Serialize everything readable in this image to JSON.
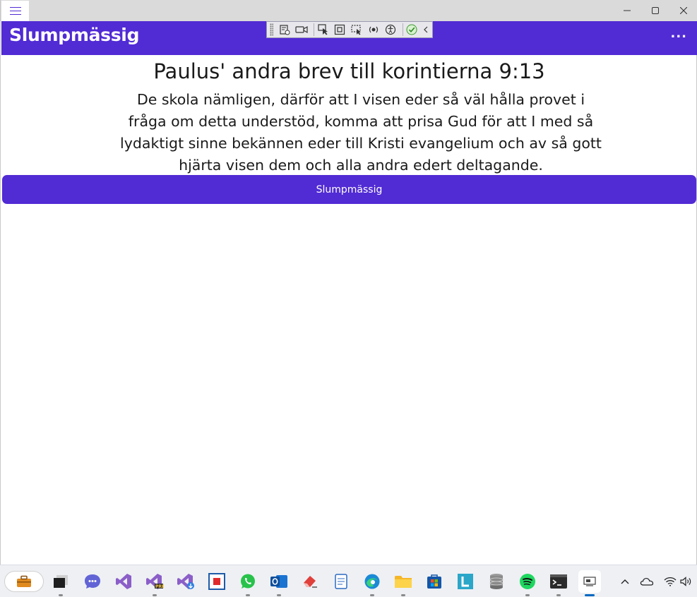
{
  "window": {
    "app_title": "Slumpmässig",
    "more_label": "..."
  },
  "content": {
    "verse_reference": "Paulus' andra brev till korintierna 9:13",
    "verse_text": "De skola nämligen, därför att I visen eder så väl hålla provet i fråga om detta understöd, komma att prisa Gud för att I med så lydaktigt sinne bekännen eder till Kristi evangelium och av så gott hjärta visen dem och alla andra edert deltagande.",
    "random_button_label": "Slumpmässig"
  },
  "colors": {
    "accent": "#512bd4",
    "text": "#1a1a1a",
    "background": "#ffffff"
  },
  "taskbar": {
    "items": [
      "briefcase-icon",
      "terminal-window-icon",
      "teams-chat-icon",
      "visual-studio-icon",
      "visual-studio-preview-icon",
      "visual-studio-installer-icon",
      "app-red-square-icon",
      "whatsapp-icon",
      "outlook-icon",
      "eraser-app-icon",
      "notepad-icon",
      "edge-icon",
      "file-explorer-icon",
      "store-icon",
      "l-app-icon",
      "database-icon",
      "spotify-icon",
      "windows-terminal-icon",
      "maui-app-icon"
    ]
  }
}
